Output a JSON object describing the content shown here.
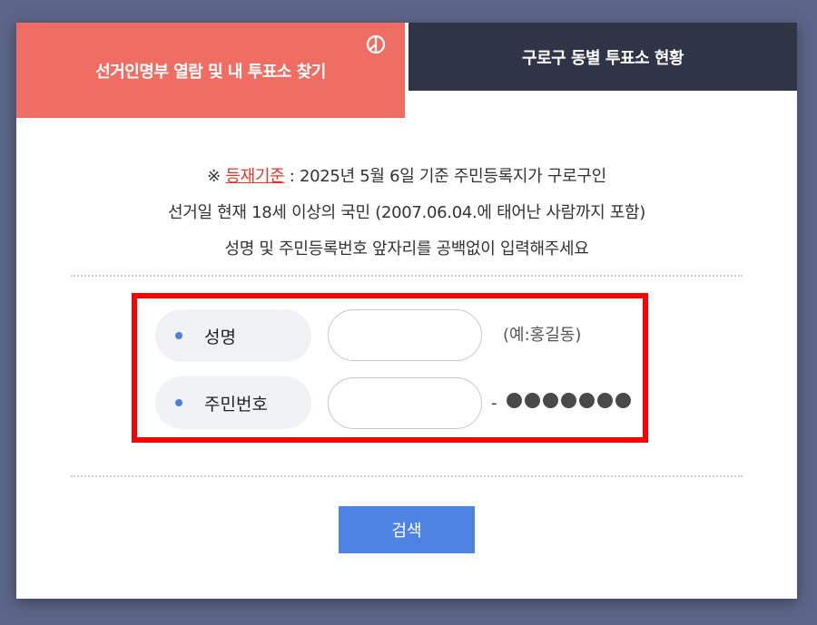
{
  "tabs": {
    "active_label": "선거인명부 열람 및 내 투표소 찾기",
    "inactive_label": "구로구 동별 투표소 현황",
    "active_icon": "vote-symbol-icon",
    "active_color": "#ef6d63",
    "inactive_color": "#2f3446"
  },
  "notice": {
    "prefix": "※ ",
    "link_text": "등재기준",
    "line1_rest": " : 2025년 5월 6일 기준 주민등록지가 구로구인",
    "line2": "선거일 현재 18세 이상의 국민 (2007.06.04.에 태어난 사람까지 포함)",
    "line3": "성명 및 주민등록번호 앞자리를 공백없이 입력해주세요",
    "link_color": "#e2382b"
  },
  "form": {
    "name_label": "성명",
    "name_value": "",
    "name_hint": "(예:홍길동)",
    "id_label": "주민번호",
    "id_value": "",
    "id_dash": "-",
    "id_masked_digits": 7,
    "highlight_color": "#ff0000"
  },
  "actions": {
    "search_label": "검색",
    "search_color": "#4f83e3"
  }
}
